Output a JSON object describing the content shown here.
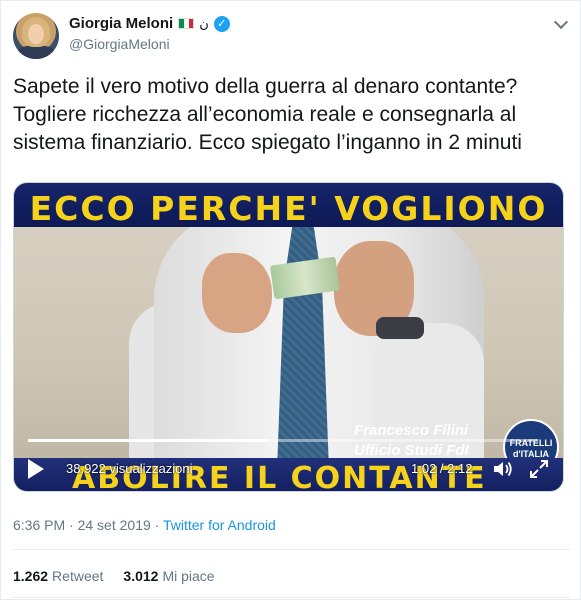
{
  "author": {
    "display_name": "Giorgia Meloni",
    "name_suffix": "ن",
    "handle": "@GiorgiaMeloni",
    "verified": true,
    "flag_colors": [
      "#009246",
      "#ffffff",
      "#ce2b37"
    ]
  },
  "tweet": {
    "text": "Sapete il vero motivo della guerra al denaro contante? Togliere ricchezza all’economia reale e consegnarla al sistema finanziario. Ecco spiegato l’inganno in 2 minuti"
  },
  "video": {
    "banner_top": "ECCO PERCHE' VOGLIONO",
    "banner_bottom": "ABOLIRE IL CONTANTE",
    "speaker_name": "Francesco Filini",
    "speaker_role": "Ufficio Studi FdI",
    "logo_text": "FRATELLI d'ITALIA",
    "views": "38.922 visualizzazioni",
    "time": "1:02 / 2:12",
    "progress_fraction": 0.47
  },
  "meta": {
    "time": "6:36 PM",
    "separator": "·",
    "date": "24 set 2019",
    "source": "Twitter for Android"
  },
  "stats": {
    "retweets_count": "1.262",
    "retweets_label": "Retweet",
    "likes_count": "3.012",
    "likes_label": "Mi piace"
  },
  "colors": {
    "accent": "#1da1f2",
    "link": "#1b95e0",
    "banner_yellow": "#f6d21a",
    "banner_blue": "#17246a"
  }
}
